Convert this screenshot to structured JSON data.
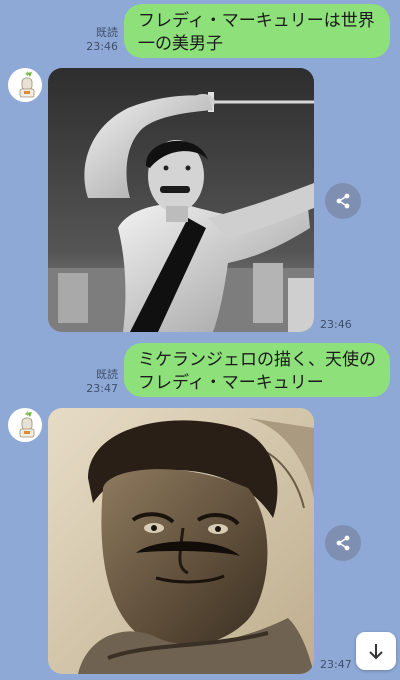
{
  "messages": [
    {
      "text_line1": "フレディ・マーキュリーは世界",
      "text_line2": "一の美男子",
      "read": "既読",
      "time": "23:46"
    },
    {
      "image_desc": "black-and-white-sword-photo",
      "time": "23:46"
    },
    {
      "text_line1": "ミケランジェロの描く、天使の",
      "text_line2": "フレディ・マーキュリー",
      "read": "既読",
      "time": "23:47"
    },
    {
      "image_desc": "sepia-angel-portrait",
      "time": "23:47"
    }
  ],
  "colors": {
    "chat_background": "#8fa9d6",
    "outgoing_bubble": "#8de07a"
  },
  "icons": {
    "share": "share-icon",
    "scroll_down": "arrow-down-icon"
  }
}
